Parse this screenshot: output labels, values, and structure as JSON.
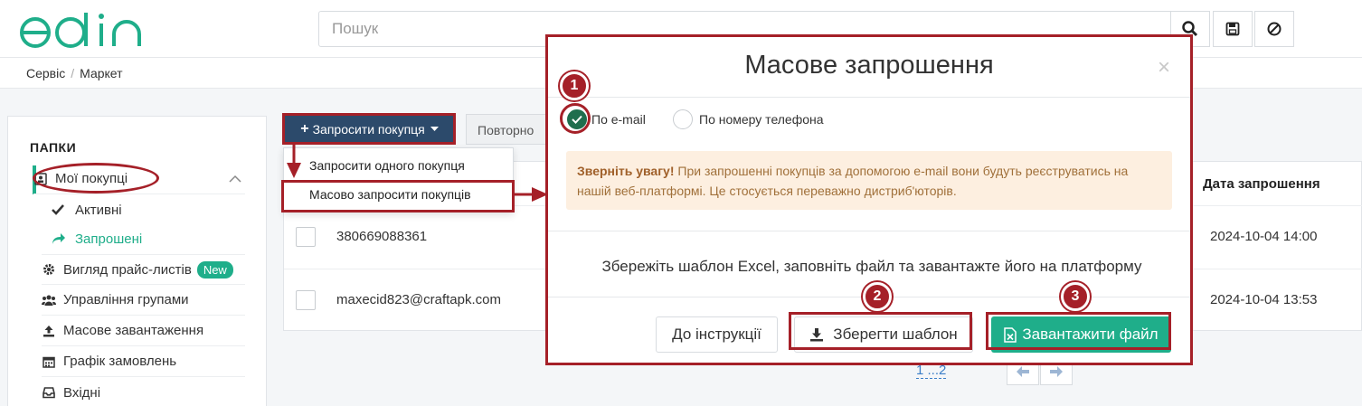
{
  "header": {
    "logo_text": "edin",
    "search_placeholder": "Пошук"
  },
  "breadcrumb": {
    "items": [
      "Сервіс",
      "Маркет"
    ],
    "separator": "/"
  },
  "sidebar": {
    "title": "ПАПКИ",
    "my_buyers": "Мої покупці",
    "active": "Активні",
    "invited": "Запрошені",
    "items": [
      {
        "label": "Вигляд прайс-листів",
        "badge": "New"
      },
      {
        "label": "Управління групами"
      },
      {
        "label": "Масове завантаження"
      },
      {
        "label": "Графік замовлень"
      },
      {
        "label": "Вхідні"
      }
    ]
  },
  "toolbar": {
    "invite_label": "Запросити покупця",
    "repeat_label": "Повторно"
  },
  "dropdown": {
    "items": [
      "Запросити одного покупця",
      "Масово запросити покупців"
    ]
  },
  "table": {
    "date_header": "Дата запрошення",
    "rows": [
      {
        "contact": "380669088361",
        "date": "2024-10-04 14:00"
      },
      {
        "contact": "maxecid823@craftapk.com",
        "date": "2024-10-04 13:53"
      }
    ]
  },
  "pagination": {
    "pages": "1 ...2"
  },
  "modal": {
    "title": "Масове запрошення",
    "close": "×",
    "option_email": "По e-mail",
    "option_phone": "По номеру телефона",
    "alert_bold": "Зверніть увагу!",
    "alert_text": " При запрошенні покупців за допомогою e-mail вони будуть реєструватись на нашій веб-платформі. Це стосується переважно дистриб'юторів.",
    "instruction_text": "Збережіть шаблон Excel, заповніть файл та завантажте його на платформу",
    "btn_instructions": "До інструкції",
    "btn_save_template": "Зберегти шаблон",
    "btn_upload": "Завантажити файл"
  },
  "annotations": {
    "markers": [
      "1",
      "2",
      "3"
    ]
  },
  "colors": {
    "brand": "#1fae8a",
    "navy": "#2c4a6b",
    "annotation": "#a52028"
  }
}
